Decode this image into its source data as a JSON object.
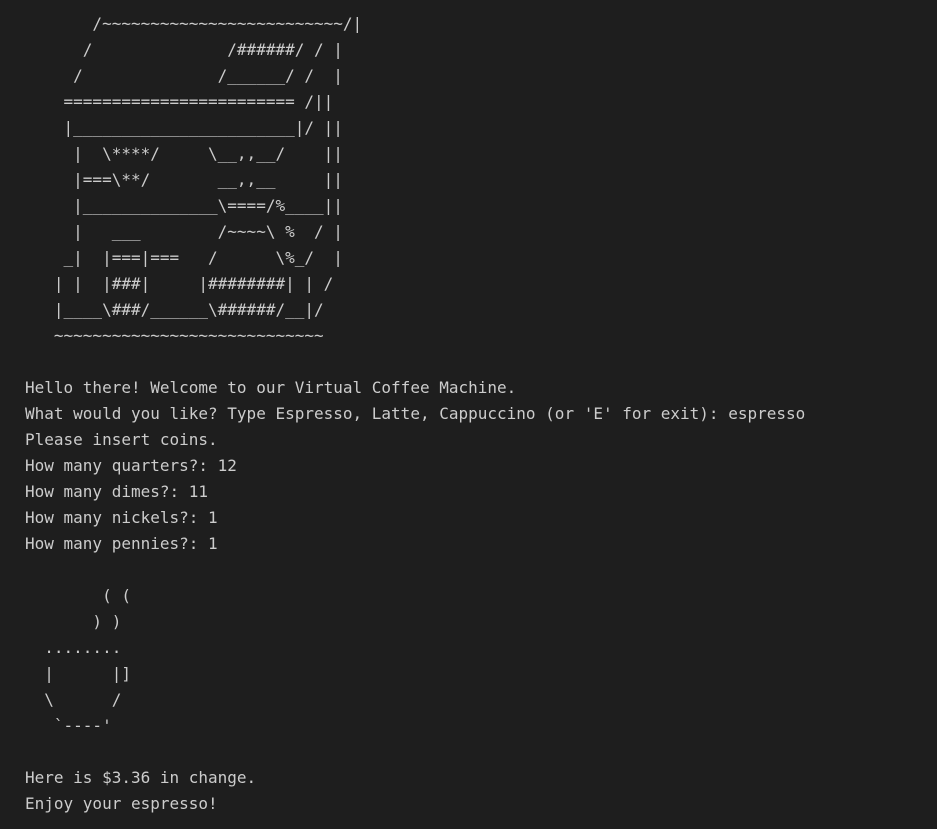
{
  "terminal": {
    "colors": {
      "background": "#1e1e1e",
      "text": "#cccccc"
    },
    "machine_art": [
      "       /~~~~~~~~~~~~~~~~~~~~~~~~~/|",
      "      /              /######/ / |",
      "     /              /______/ /  |",
      "    ======================== /||",
      "    |_______________________|/ ||",
      "     |  \\****/     \\__,,__/    ||",
      "     |===\\**/       __,,__     ||",
      "     |______________\\====/%____||",
      "     |   ___        /~~~~\\ %  / |",
      "    _|  |===|===   /      \\%_/  |",
      "   | |  |###|     |########| | /",
      "   |____\\###/______\\######/__|/",
      "   ~~~~~~~~~~~~~~~~~~~~~~~~~~~~"
    ],
    "session": [
      "Hello there! Welcome to our Virtual Coffee Machine.",
      "What would you like? Type Espresso, Latte, Cappuccino (or 'E' for exit): espresso",
      "Please insert coins.",
      "How many quarters?: 12",
      "How many dimes?: 11",
      "How many nickels?: 1",
      "How many pennies?: 1"
    ],
    "cup_art": [
      "        ( (",
      "       ) )",
      "  ........",
      "  |      |]",
      "  \\      /",
      "   `----'"
    ],
    "result": [
      "Here is $3.36 in change.",
      "Enjoy your espresso!"
    ]
  }
}
